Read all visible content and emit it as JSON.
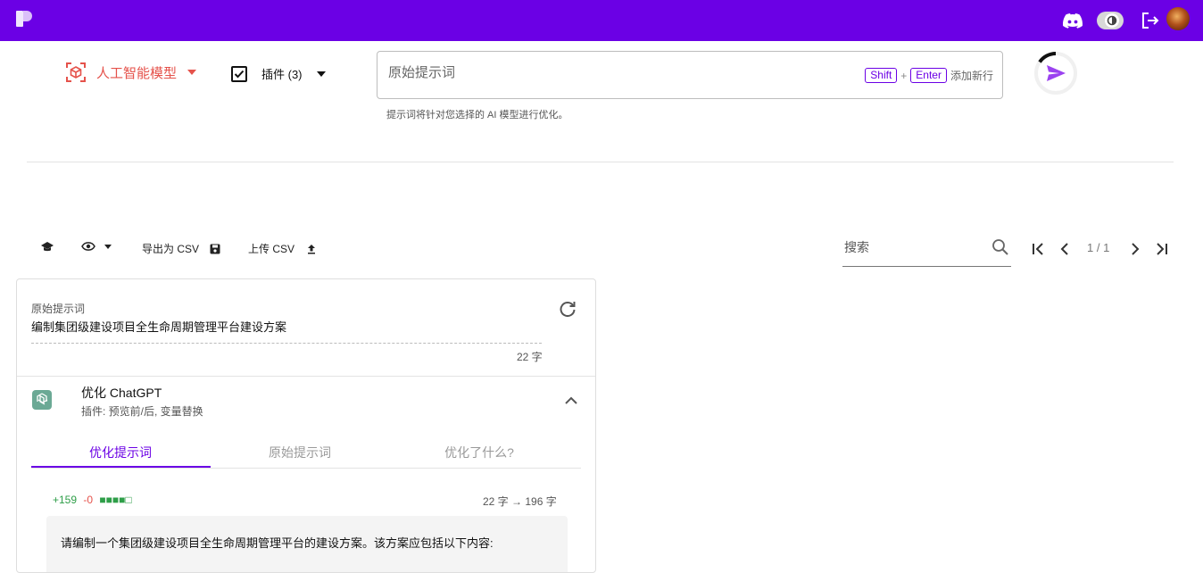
{
  "header": {
    "icons": [
      "logo-icon",
      "discord-icon",
      "eye-toggle-icon",
      "logout-icon",
      "avatar"
    ]
  },
  "model_selector": {
    "label": "人工智能模型",
    "color": "#e5524b"
  },
  "plugins": {
    "label": "插件 (3)"
  },
  "prompt": {
    "placeholder": "原始提示词",
    "hint_shift": "Shift",
    "hint_plus": "+",
    "hint_enter": "Enter",
    "hint_text": "添加新行",
    "helper": "提示词将针对您选择的 AI 模型进行优化。"
  },
  "toolbar": {
    "export_label": "导出为 CSV",
    "upload_label": "上传 CSV",
    "search_placeholder": "搜索",
    "page_text": "1 / 1"
  },
  "card": {
    "original_caption": "原始提示词",
    "original_text": "编制集团级建设项目全生命周期管理平台建设方案",
    "char_count": "22 字",
    "optimizer_title": "优化 ChatGPT",
    "optimizer_subtitle": "插件: 预览前/后, 变量替换",
    "tabs": [
      {
        "label": "优化提示词",
        "active": true
      },
      {
        "label": "原始提示词",
        "active": false
      },
      {
        "label": "优化了什么?",
        "active": false
      }
    ],
    "diff_plus": "+159",
    "diff_minus": "-0",
    "diff_bars": "■■■■□",
    "diff_count": "22 字 → 196 字",
    "result_text": "请编制一个集团级建设项目全生命周期管理平台的建设方案。该方案应包括以下内容:"
  },
  "colors": {
    "accent": "#6b00e5",
    "model": "#e5524b",
    "positive": "#2e9e48"
  }
}
